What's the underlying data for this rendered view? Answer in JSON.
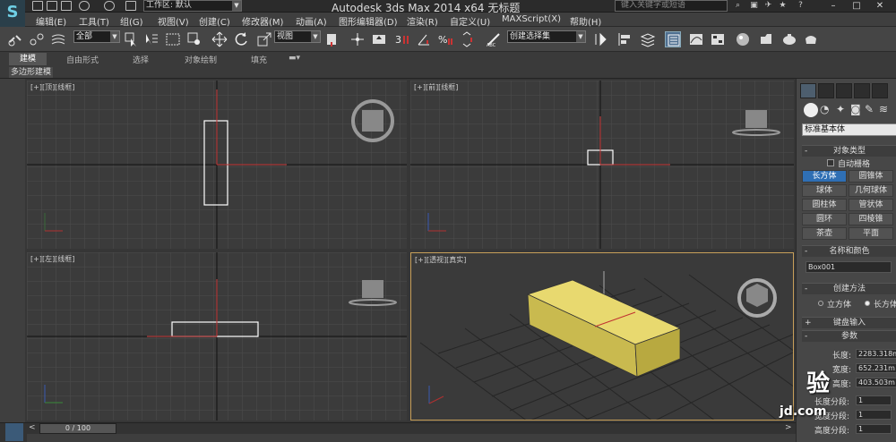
{
  "titlebar": {
    "workspace_label": "工作区: 默认",
    "window_title": "Autodesk 3ds Max  2014 x64      无标题",
    "search_placeholder": "键入关键字或短语"
  },
  "menu": [
    {
      "label": "编辑(E)"
    },
    {
      "label": "工具(T)"
    },
    {
      "label": "组(G)"
    },
    {
      "label": "视图(V)"
    },
    {
      "label": "创建(C)"
    },
    {
      "label": "修改器(M)"
    },
    {
      "label": "动画(A)"
    },
    {
      "label": "图形编辑器(D)"
    },
    {
      "label": "渲染(R)"
    },
    {
      "label": "自定义(U)"
    },
    {
      "label": "MAXScript(X)"
    },
    {
      "label": "帮助(H)"
    }
  ],
  "toolbar": {
    "selection_filter": "全部",
    "ref_coord": "视图",
    "named_selection": "创建选择集"
  },
  "ribbon": {
    "tabs": [
      "建模",
      "自由形式",
      "选择",
      "对象绘制",
      "填充"
    ],
    "sub_label": "多边形建模"
  },
  "viewports": {
    "top": "[+][顶][线框]",
    "front": "[+][前][线框]",
    "left": "[+][左][线框]",
    "perspective": "[+][透视][真实]"
  },
  "command_panel": {
    "category": "标准基本体",
    "object_type_title": "对象类型",
    "autogrid": "自动栅格",
    "object_buttons": [
      "长方体",
      "圆锥体",
      "球体",
      "几何球体",
      "圆柱体",
      "管状体",
      "圆环",
      "四棱锥",
      "茶壶",
      "平面"
    ],
    "name_color_title": "名称和颜色",
    "object_name": "Box001",
    "creation_method_title": "创建方法",
    "creation_cube": "立方体",
    "creation_box": "长方体",
    "keyboard_entry_title": "键盘输入",
    "params_title": "参数",
    "length_label": "长度:",
    "length_value": "2283.318m",
    "width_label": "宽度:",
    "width_value": "652.231m",
    "height_label": "高度:",
    "height_value": "403.503m",
    "length_segs_label": "长度分段:",
    "length_segs": "1",
    "width_segs_label": "宽度分段:",
    "width_segs": "1",
    "height_segs_label": "高度分段:",
    "height_segs": "1"
  },
  "timeline": {
    "frame": "0 / 100"
  },
  "watermark": {
    "text": "验",
    "url": "jd.com"
  },
  "colors": {
    "accent": "#2f6fb4",
    "box_fill": "#d4c55e",
    "active_border": "#c8a05a"
  }
}
